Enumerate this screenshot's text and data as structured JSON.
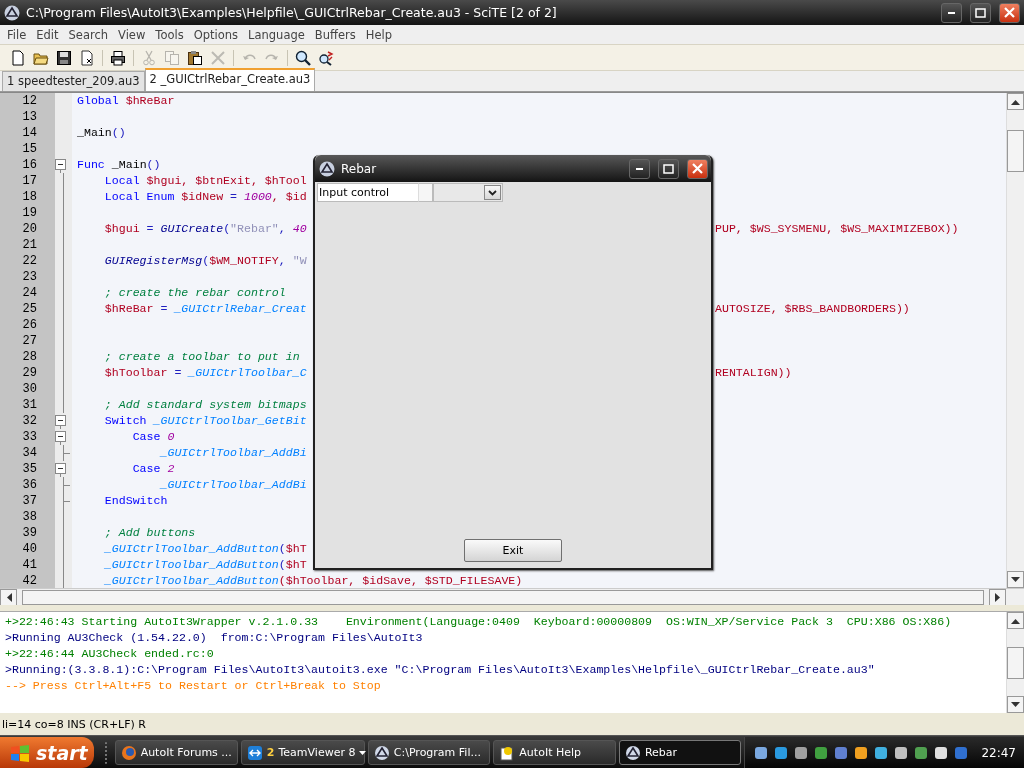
{
  "window": {
    "title": "C:\\Program Files\\AutoIt3\\Examples\\Helpfile\\_GUICtrlRebar_Create.au3 - SciTE [2 of 2]"
  },
  "menu": [
    "File",
    "Edit",
    "Search",
    "View",
    "Tools",
    "Options",
    "Language",
    "Buffers",
    "Help"
  ],
  "toolbar": {
    "groups": [
      [
        {
          "kind": "new",
          "disabled": false
        },
        {
          "kind": "open",
          "disabled": false
        },
        {
          "kind": "save",
          "disabled": false
        },
        {
          "kind": "close",
          "disabled": false
        }
      ],
      [
        {
          "kind": "print",
          "disabled": false
        }
      ],
      [
        {
          "kind": "cut",
          "disabled": true
        },
        {
          "kind": "copy",
          "disabled": true
        },
        {
          "kind": "paste",
          "disabled": false
        },
        {
          "kind": "delete",
          "disabled": true
        }
      ],
      [
        {
          "kind": "undo",
          "disabled": true
        },
        {
          "kind": "redo",
          "disabled": true
        }
      ],
      [
        {
          "kind": "find",
          "disabled": false
        },
        {
          "kind": "replace",
          "disabled": false
        }
      ]
    ]
  },
  "tabs": [
    {
      "label": "1 speedtester_209.au3",
      "selected": false
    },
    {
      "label": "2 _GUICtrlRebar_Create.au3",
      "selected": true
    }
  ],
  "editor": {
    "lines": [
      {
        "number": "12",
        "kind": "plain",
        "left": [
          {
            "kind": "keyword",
            "text": "Global"
          },
          {
            "kind": "variable",
            "text": " $hReBar"
          }
        ]
      },
      {
        "number": "13",
        "kind": "plain"
      },
      {
        "number": "14",
        "kind": "plain",
        "left": [
          {
            "kind": "plain",
            "text": "_Main"
          },
          {
            "kind": "operator",
            "text": "()"
          }
        ]
      },
      {
        "number": "15",
        "kind": "plain"
      },
      {
        "number": "16",
        "kind": "fold_start",
        "left": [
          {
            "kind": "keyword",
            "text": "Func"
          },
          {
            "kind": "plain",
            "text": " _Main"
          },
          {
            "kind": "operator",
            "text": "()"
          }
        ]
      },
      {
        "number": "17",
        "kind": "fold_body",
        "left": [
          {
            "kind": "keyword",
            "text": "    Local"
          },
          {
            "kind": "variable",
            "text": " $hgui, $btnExit, $hTool"
          }
        ]
      },
      {
        "number": "18",
        "kind": "fold_body",
        "left": [
          {
            "kind": "keyword",
            "text": "    Local Enum"
          },
          {
            "kind": "variable",
            "text": " $idNew"
          },
          {
            "kind": "operator",
            "text": " = "
          },
          {
            "kind": "number",
            "text": "1000"
          },
          {
            "kind": "variable",
            "text": ", $id"
          }
        ]
      },
      {
        "number": "19",
        "kind": "fold_body"
      },
      {
        "number": "20",
        "kind": "fold_body",
        "left": [
          {
            "kind": "variable",
            "text": "    $hgui"
          },
          {
            "kind": "operator",
            "text": " = "
          },
          {
            "kind": "builtin",
            "text": "GUICreate"
          },
          {
            "kind": "operator",
            "text": "("
          },
          {
            "kind": "string",
            "text": "\"Rebar\""
          },
          {
            "kind": "operator",
            "text": ", "
          },
          {
            "kind": "number",
            "text": "40"
          }
        ],
        "right": [
          {
            "kind": "variable",
            "text": "PUP, $WS_SYSMENU, $WS_MAXIMIZEBOX))"
          }
        ]
      },
      {
        "number": "21",
        "kind": "fold_body"
      },
      {
        "number": "22",
        "kind": "fold_body",
        "left": [
          {
            "kind": "builtin",
            "text": "    GUIRegisterMsg"
          },
          {
            "kind": "operator",
            "text": "("
          },
          {
            "kind": "variable",
            "text": "$WM_NOTIFY"
          },
          {
            "kind": "operator",
            "text": ", "
          },
          {
            "kind": "string",
            "text": "\"W"
          }
        ]
      },
      {
        "number": "23",
        "kind": "fold_body"
      },
      {
        "number": "24",
        "kind": "fold_body",
        "left": [
          {
            "kind": "comment",
            "text": "    ; create the rebar control"
          }
        ]
      },
      {
        "number": "25",
        "kind": "fold_body",
        "left": [
          {
            "kind": "variable",
            "text": "    $hReBar"
          },
          {
            "kind": "operator",
            "text": " = "
          },
          {
            "kind": "udf",
            "text": "_GUICtrlRebar_Creat"
          }
        ],
        "right": [
          {
            "kind": "variable",
            "text": "AUTOSIZE, $RBS_BANDBORDERS))"
          }
        ]
      },
      {
        "number": "26",
        "kind": "fold_body"
      },
      {
        "number": "27",
        "kind": "fold_body"
      },
      {
        "number": "28",
        "kind": "fold_body",
        "left": [
          {
            "kind": "comment",
            "text": "    ; create a toolbar to put in"
          }
        ]
      },
      {
        "number": "29",
        "kind": "fold_body",
        "left": [
          {
            "kind": "variable",
            "text": "    $hToolbar"
          },
          {
            "kind": "operator",
            "text": " = "
          },
          {
            "kind": "udf",
            "text": "_GUICtrlToolbar_C"
          }
        ],
        "right": [
          {
            "kind": "variable",
            "text": "RENTALIGN))"
          }
        ]
      },
      {
        "number": "30",
        "kind": "fold_body"
      },
      {
        "number": "31",
        "kind": "fold_body",
        "left": [
          {
            "kind": "comment",
            "text": "    ; Add standard system bitmaps"
          }
        ]
      },
      {
        "number": "32",
        "kind": "fold_start",
        "left": [
          {
            "kind": "keyword",
            "text": "    Switch"
          },
          {
            "kind": "udf",
            "text": " _GUICtrlToolbar_GetBit"
          }
        ]
      },
      {
        "number": "33",
        "kind": "fold_start",
        "left": [
          {
            "kind": "keyword",
            "text": "        Case"
          },
          {
            "kind": "number",
            "text": " 0"
          }
        ]
      },
      {
        "number": "34",
        "kind": "fold_end",
        "left": [
          {
            "kind": "udf",
            "text": "            _GUICtrlToolbar_AddBi"
          }
        ]
      },
      {
        "number": "35",
        "kind": "fold_start",
        "left": [
          {
            "kind": "keyword",
            "text": "        Case"
          },
          {
            "kind": "number",
            "text": " 2"
          }
        ]
      },
      {
        "number": "36",
        "kind": "fold_end",
        "left": [
          {
            "kind": "udf",
            "text": "            _GUICtrlToolbar_AddBi"
          }
        ]
      },
      {
        "number": "37",
        "kind": "fold_end",
        "left": [
          {
            "kind": "keyword",
            "text": "    EndSwitch"
          }
        ]
      },
      {
        "number": "38",
        "kind": "fold_body"
      },
      {
        "number": "39",
        "kind": "fold_body",
        "left": [
          {
            "kind": "comment",
            "text": "    ; Add buttons"
          }
        ]
      },
      {
        "number": "40",
        "kind": "fold_body",
        "left": [
          {
            "kind": "udf",
            "text": "    _GUICtrlToolbar_AddButton"
          },
          {
            "kind": "operator",
            "text": "("
          },
          {
            "kind": "variable",
            "text": "$hT"
          }
        ]
      },
      {
        "number": "41",
        "kind": "fold_body",
        "left": [
          {
            "kind": "udf",
            "text": "    _GUICtrlToolbar_AddButton"
          },
          {
            "kind": "operator",
            "text": "("
          },
          {
            "kind": "variable",
            "text": "$hT"
          }
        ]
      },
      {
        "number": "42",
        "kind": "fold_body",
        "left": [
          {
            "kind": "udf",
            "text": "    _GUICtrlToolbar_AddButton"
          },
          {
            "kind": "variable",
            "text": "($hToolbar, $idSave, $STD_FILESAVE)"
          }
        ]
      }
    ]
  },
  "output": {
    "lines": [
      {
        "kind": "success",
        "text": "+>22:46:43 Starting AutoIt3Wrapper v.2.1.0.33    Environment(Language:0409  Keyboard:00000809  OS:WIN_XP/Service Pack 3  CPU:X86 OS:X86)"
      },
      {
        "kind": "info",
        "text": ">Running AU3Check (1.54.22.0)  from:C:\\Program Files\\AutoIt3"
      },
      {
        "kind": "success",
        "text": "+>22:46:44 AU3Check ended.rc:0"
      },
      {
        "kind": "info",
        "text": ">Running:(3.3.8.1):C:\\Program Files\\AutoIt3\\autoit3.exe \"C:\\Program Files\\AutoIt3\\Examples\\Helpfile\\_GUICtrlRebar_Create.au3\""
      },
      {
        "kind": "warning",
        "text": "--> Press Ctrl+Alt+F5 to Restart or Ctrl+Break to Stop"
      }
    ]
  },
  "status_bar": "li=14 co=8 INS (CR+LF) R",
  "dialog": {
    "title": "Rebar",
    "input": {
      "value": "Input control"
    },
    "exit_button": "Exit"
  },
  "taskbar": {
    "start": "start",
    "items": [
      {
        "label": "AutoIt Forums ...",
        "selected": false
      },
      {
        "count": "2",
        "label": "TeamViewer 8",
        "menu": true,
        "selected": false
      },
      {
        "label": "C:\\Program Fil...",
        "selected": false
      },
      {
        "label": "AutoIt Help",
        "selected": false
      },
      {
        "label": "Rebar",
        "selected": true
      }
    ],
    "clock": "22:47"
  }
}
